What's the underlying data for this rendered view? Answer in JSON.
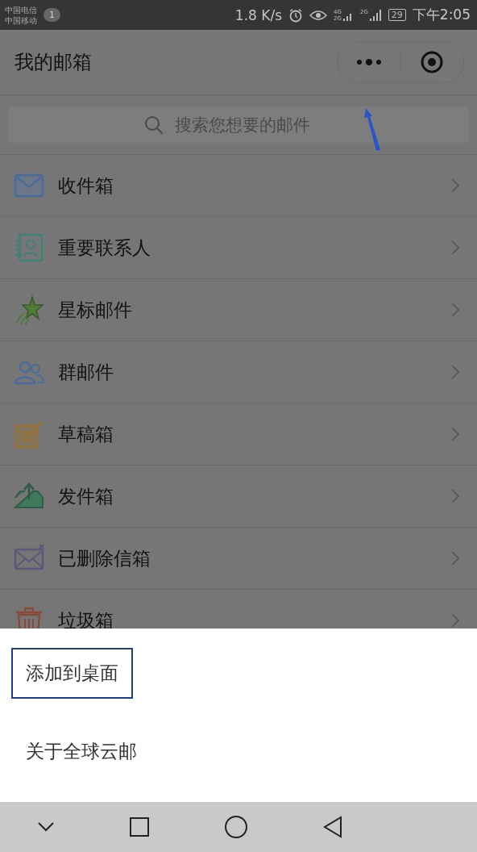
{
  "status_bar": {
    "carriers": [
      "中国电信",
      "中国移动"
    ],
    "badge": "1",
    "speed": "1.8 K/s",
    "network_labels": [
      "4G",
      "2G",
      "2G"
    ],
    "battery": "29",
    "time": "下午2:05"
  },
  "header": {
    "title": "我的邮箱"
  },
  "search": {
    "placeholder": "搜索您想要的邮件"
  },
  "folders": [
    {
      "label": "收件箱",
      "kind": "inbox",
      "color": "#4a6c9a"
    },
    {
      "label": "重要联系人",
      "kind": "contacts",
      "color": "#3f7f7a"
    },
    {
      "label": "星标邮件",
      "kind": "starred",
      "color": "#4f7a3a"
    },
    {
      "label": "群邮件",
      "kind": "group",
      "color": "#4a6c9a"
    },
    {
      "label": "草稿箱",
      "kind": "drafts",
      "color": "#9a7030"
    },
    {
      "label": "发件箱",
      "kind": "outbox",
      "color": "#3f7a5a"
    },
    {
      "label": "已删除信箱",
      "kind": "deleted",
      "color": "#5a5a78"
    },
    {
      "label": "垃圾箱",
      "kind": "spam",
      "color": "#8a4838"
    }
  ],
  "sheet": [
    {
      "label": "添加到桌面",
      "highlighted": true
    },
    {
      "label": "关于全球云邮",
      "highlighted": false
    }
  ]
}
